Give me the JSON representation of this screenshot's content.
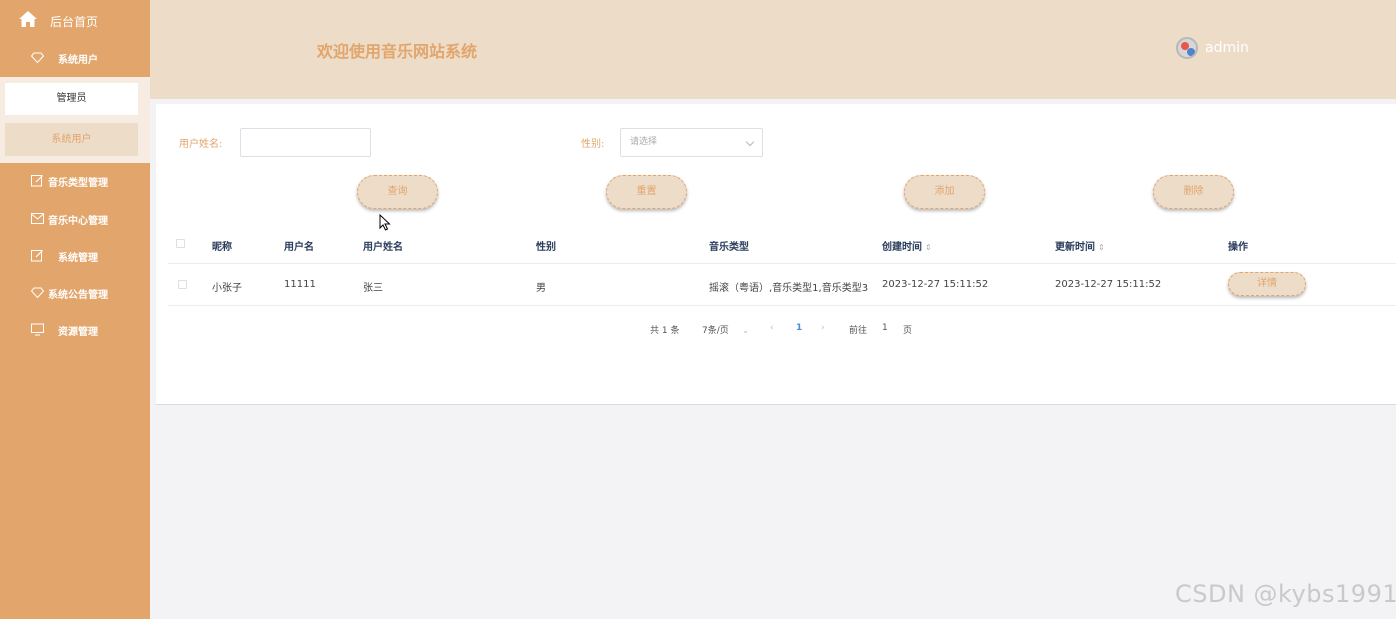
{
  "sidebar": {
    "home_label": "后台首页",
    "items": [
      {
        "label": "系统用户",
        "icon": "diamond-icon"
      },
      {
        "label": "音乐类型管理",
        "icon": "edit-icon"
      },
      {
        "label": "音乐中心管理",
        "icon": "message-icon"
      },
      {
        "label": "系统管理",
        "icon": "edit-icon"
      },
      {
        "label": "系统公告管理",
        "icon": "diamond-icon"
      },
      {
        "label": "资源管理",
        "icon": "monitor-icon"
      }
    ],
    "submenu": [
      {
        "label": "管理员"
      },
      {
        "label": "系统用户"
      }
    ]
  },
  "header": {
    "title": "欢迎使用音乐网站系统",
    "username": "admin"
  },
  "search": {
    "name_label": "用户姓名:",
    "name_value": "",
    "gender_label": "性别:",
    "gender_placeholder": "请选择"
  },
  "actions": {
    "query": "查询",
    "reset": "重置",
    "add": "添加",
    "delete": "删除"
  },
  "table": {
    "columns": [
      "昵称",
      "用户名",
      "用户姓名",
      "性别",
      "音乐类型",
      "创建时间",
      "更新时间",
      "操作"
    ],
    "rows": [
      {
        "nickname": "小张子",
        "username": "11111",
        "realname": "张三",
        "gender": "男",
        "music_type": "摇滚（粤语）,音乐类型1,音乐类型3",
        "created": "2023-12-27 15:11:52",
        "updated": "2023-12-27 15:11:52",
        "action": "详情"
      }
    ]
  },
  "pagination": {
    "total": "共 1 条",
    "page_size": "7条/页",
    "current_page": "1",
    "goto_prefix": "前往",
    "goto_value": "1",
    "goto_suffix": "页"
  },
  "watermark": "CSDN @kybs1991",
  "colors": {
    "sidebar": "#e2a56c",
    "header": "#ecdcc8",
    "accent": "#e2a56c",
    "page_active": "#4a8fd6"
  }
}
